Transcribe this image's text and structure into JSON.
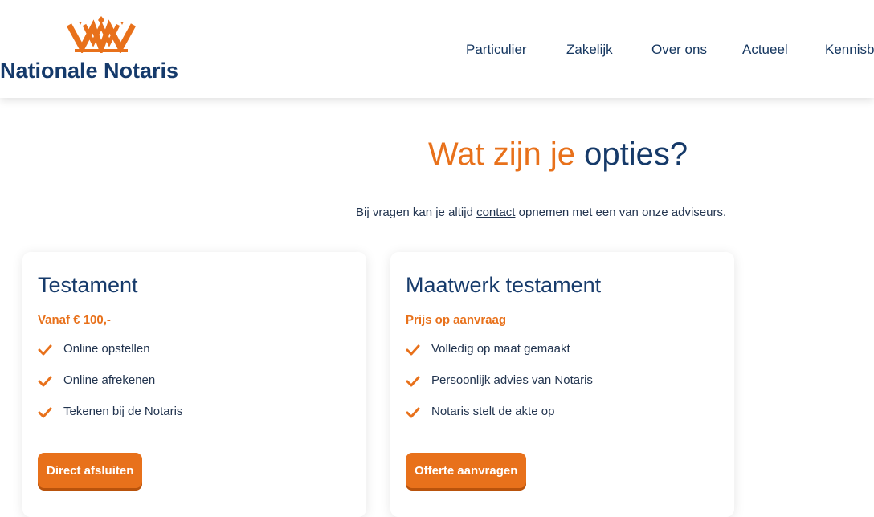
{
  "brand": {
    "name": "Nationale Notaris",
    "accent": "#e8711b",
    "navy": "#163a69"
  },
  "nav": {
    "items": [
      "Particulier",
      "Zakelijk",
      "Over ons",
      "Actueel",
      "Kennisb"
    ]
  },
  "hero": {
    "title_part1": "Wat zijn je",
    "title_part2": "opties?"
  },
  "intro": {
    "before": "Bij vragen kan je altijd ",
    "link": "contact",
    "after": " opnemen met een van onze adviseurs."
  },
  "cards": [
    {
      "title": "Testament",
      "price": "Vanaf € 100,-",
      "features": [
        "Online opstellen",
        "Online afrekenen",
        "Tekenen bij de Notaris"
      ],
      "button": "Direct afsluiten",
      "icon": "checkmark-icon"
    },
    {
      "title": "Maatwerk testament",
      "price": "Prijs op aanvraag",
      "features": [
        "Volledig op maat gemaakt",
        "Persoonlijk advies van Notaris",
        "Notaris stelt de akte op"
      ],
      "button": "Offerte aanvragen",
      "icon": "checkmark-icon"
    }
  ]
}
